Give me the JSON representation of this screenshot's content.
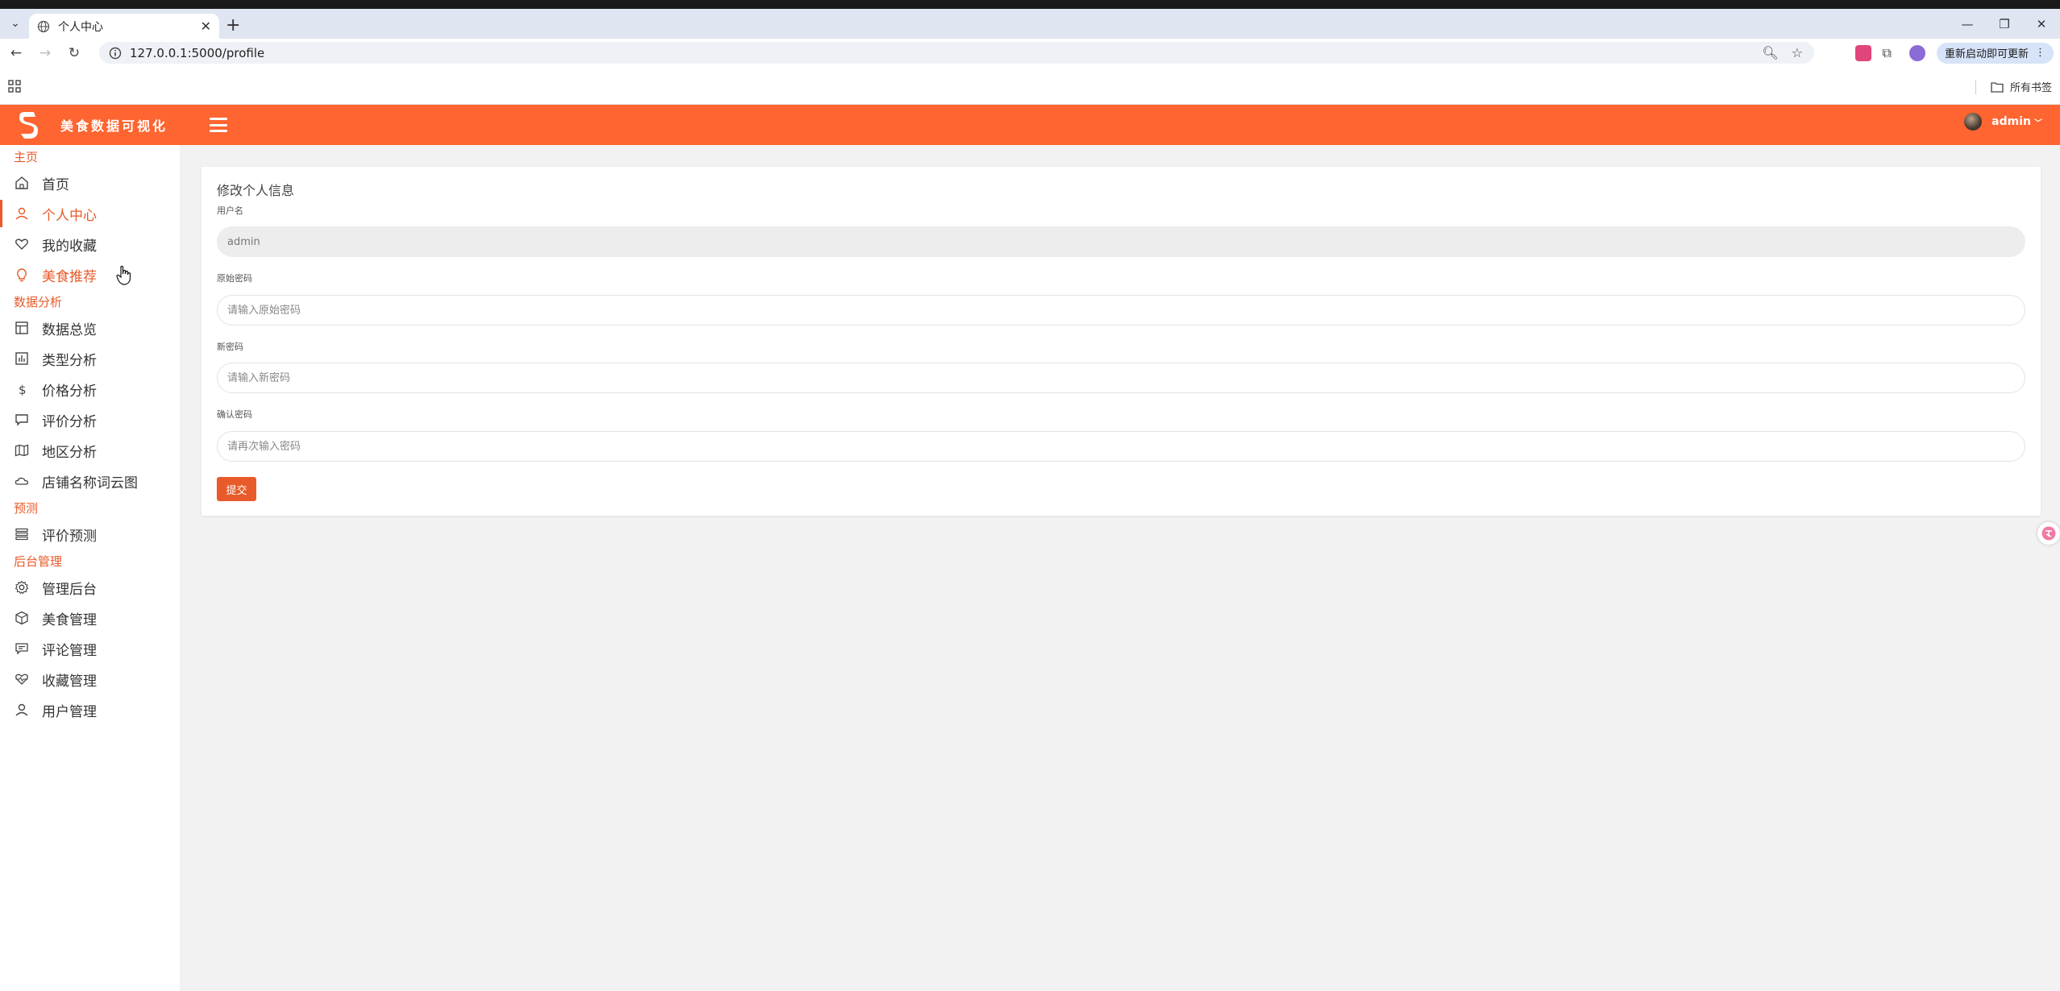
{
  "browser": {
    "tab_title": "个人中心",
    "url": "127.0.0.1:5000/profile",
    "update_label": "重新启动即可更新",
    "all_bookmarks": "所有书签"
  },
  "header": {
    "brand": "美食数据可视化",
    "username": "admin",
    "accent_color": "#fe6530"
  },
  "sidebar": {
    "sections": [
      {
        "title": "主页",
        "items": [
          {
            "label": "首页",
            "icon": "home-icon"
          },
          {
            "label": "个人中心",
            "icon": "user-icon",
            "active": true
          },
          {
            "label": "我的收藏",
            "icon": "heart-icon"
          },
          {
            "label": "美食推荐",
            "icon": "lightbulb-icon",
            "hover": true
          }
        ]
      },
      {
        "title": "数据分析",
        "items": [
          {
            "label": "数据总览",
            "icon": "layout-icon"
          },
          {
            "label": "类型分析",
            "icon": "chart-icon"
          },
          {
            "label": "价格分析",
            "icon": "dollar-icon"
          },
          {
            "label": "评价分析",
            "icon": "comment-icon"
          },
          {
            "label": "地区分析",
            "icon": "map-icon"
          },
          {
            "label": "店铺名称词云图",
            "icon": "cloud-icon"
          }
        ]
      },
      {
        "title": "预测",
        "items": [
          {
            "label": "评价预测",
            "icon": "list-icon"
          }
        ]
      },
      {
        "title": "后台管理",
        "items": [
          {
            "label": "管理后台",
            "icon": "gear-icon"
          },
          {
            "label": "美食管理",
            "icon": "box-icon"
          },
          {
            "label": "评论管理",
            "icon": "message-icon"
          },
          {
            "label": "收藏管理",
            "icon": "heart-pulse-icon"
          },
          {
            "label": "用户管理",
            "icon": "user-icon"
          }
        ]
      }
    ]
  },
  "form": {
    "title": "修改个人信息",
    "username_label": "用户名",
    "username_value": "admin",
    "old_password_label": "原始密码",
    "old_password_placeholder": "请输入原始密码",
    "new_password_label": "新密码",
    "new_password_placeholder": "请输入新密码",
    "confirm_password_label": "确认密码",
    "confirm_password_placeholder": "请再次输入密码",
    "submit_label": "提交"
  }
}
